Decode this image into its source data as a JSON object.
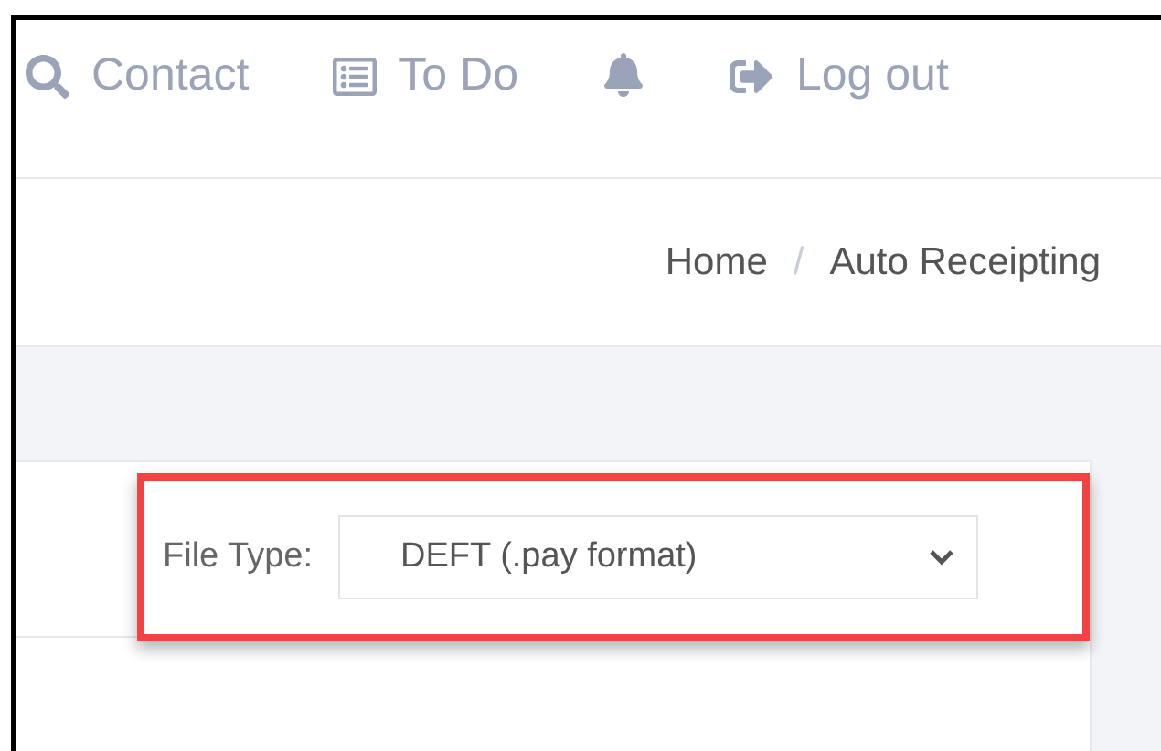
{
  "nav": [
    {
      "kind": "search",
      "label": "Contact"
    },
    {
      "kind": "list",
      "label": "To Do"
    },
    {
      "kind": "bell"
    },
    {
      "kind": "logout",
      "label": "Log out"
    }
  ],
  "breadcrumb": [
    "Home",
    "Auto Receipting"
  ],
  "breadcrumb_separator": "/",
  "filter": {
    "label": "File Type:",
    "value": "DEFT (.pay format)"
  }
}
